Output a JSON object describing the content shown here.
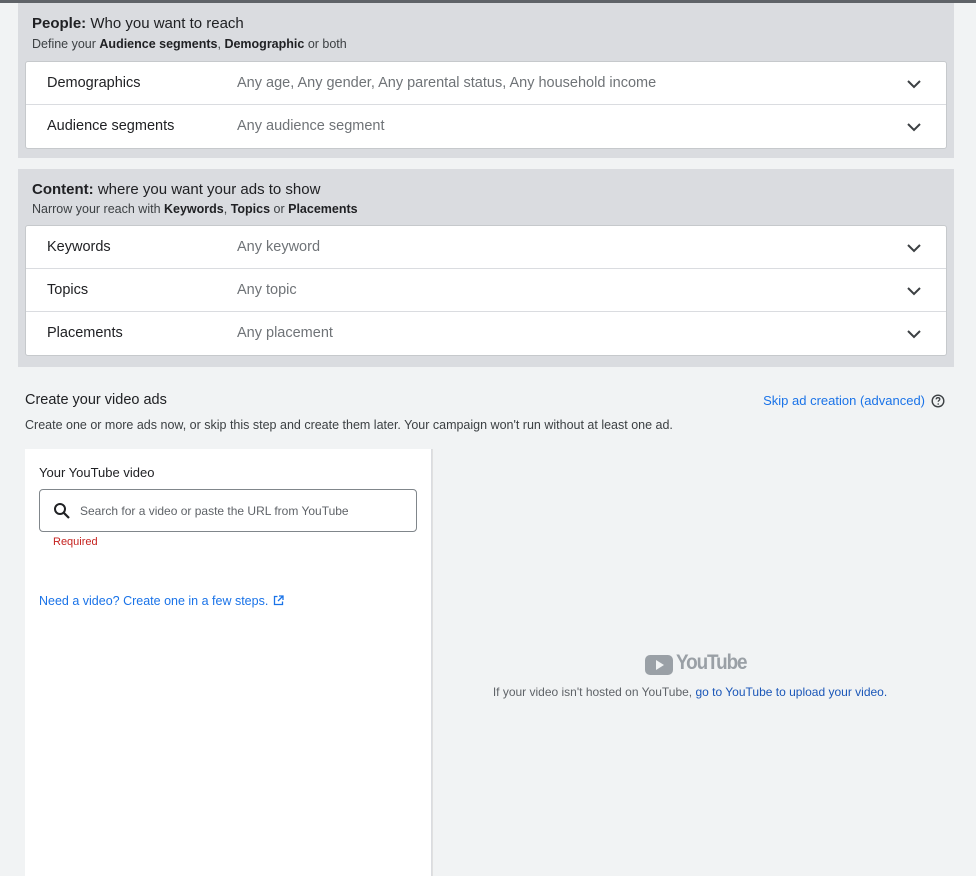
{
  "people": {
    "title_bold": "People:",
    "title_rest": " Who you want to reach",
    "sub_prefix": "Define your ",
    "sub_b1": "Audience segments",
    "sub_mid": ", ",
    "sub_b2": "Demographic",
    "sub_suffix": " or both",
    "rows": [
      {
        "label": "Demographics",
        "value": "Any age, Any gender, Any parental status, Any household income"
      },
      {
        "label": "Audience segments",
        "value": "Any audience segment"
      }
    ]
  },
  "content": {
    "title_bold": "Content:",
    "title_rest": " where you want your ads to show",
    "sub_prefix": "Narrow your reach with ",
    "sub_b1": "Keywords",
    "sub_mid": ", ",
    "sub_b2": "Topics",
    "sub_or": " or ",
    "sub_b3": "Placements",
    "rows": [
      {
        "label": "Keywords",
        "value": "Any keyword"
      },
      {
        "label": "Topics",
        "value": "Any topic"
      },
      {
        "label": "Placements",
        "value": "Any placement"
      }
    ]
  },
  "create": {
    "title": "Create your video ads",
    "subtitle": "Create one or more ads now, or skip this step and create them later. Your campaign won't run without at least one ad.",
    "skip_link": "Skip ad creation (advanced)",
    "help_icon": "help-circle-icon"
  },
  "video": {
    "label": "Your YouTube video",
    "search_placeholder": "Search for a video or paste the URL from YouTube",
    "search_value": "",
    "required": "Required",
    "need_video_link": "Need a video? Create one in a few steps."
  },
  "preview": {
    "logo_text": "YouTube",
    "note_prefix": "If your video isn't hosted on YouTube, ",
    "note_link": "go to YouTube to upload your video."
  },
  "colors": {
    "link": "#1a73e8",
    "error": "#c5221f",
    "section_bg": "#dadce0",
    "page_bg": "#f1f3f4"
  }
}
